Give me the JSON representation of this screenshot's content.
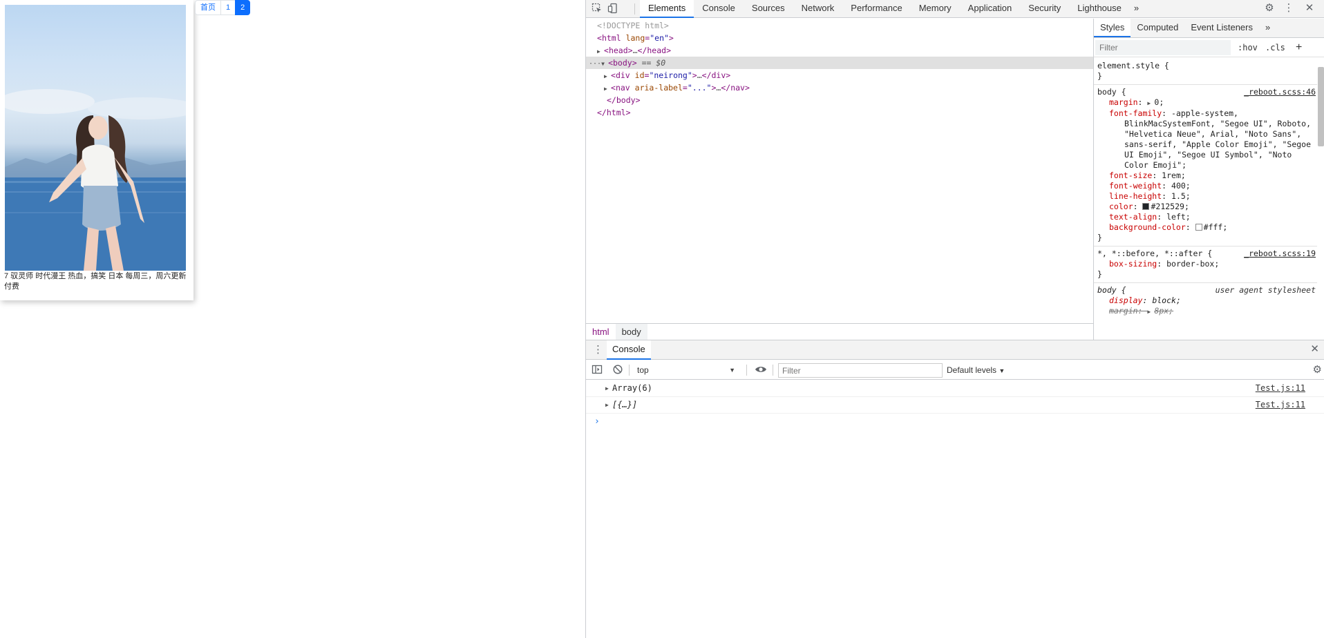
{
  "page": {
    "caption": "7 驭灵师 时代漫王 热血，搞笑 日本 每周三，周六更新付费",
    "pagination": [
      "首页",
      "1",
      "2"
    ]
  },
  "devtools": {
    "tabs": [
      "Elements",
      "Console",
      "Sources",
      "Network",
      "Performance",
      "Memory",
      "Application",
      "Security",
      "Lighthouse"
    ],
    "more_tabs": "»",
    "elements": {
      "doctype": "<!DOCTYPE html>",
      "html_open_tag": "html",
      "html_attr_name": "lang",
      "html_attr_value": "\"en\"",
      "head_tag": "head",
      "body_tag": "body",
      "body_marker": "== $0",
      "div_tag": "div",
      "div_attr_name": "id",
      "div_attr_value": "\"neirong\"",
      "nav_tag": "nav",
      "nav_attr_name": "aria-label",
      "nav_attr_value": "\"...\"",
      "ellipsis": "…",
      "dots": "···"
    },
    "breadcrumbs": [
      "html",
      "body"
    ],
    "styles": {
      "tabs": [
        "Styles",
        "Computed",
        "Event Listeners"
      ],
      "more": "»",
      "filter_placeholder": "Filter",
      "hov": ":hov",
      "cls": ".cls",
      "plus": "+",
      "element_style": "element.style {",
      "close_brace": "}",
      "rule_body": {
        "selector": "body {",
        "source": "_reboot.scss:46",
        "decls": [
          {
            "prop": "margin",
            "value": "0;",
            "arrow": true
          },
          {
            "prop": "font-family",
            "value": "-apple-system, BlinkMacSystemFont, \"Segoe UI\", Roboto, \"Helvetica Neue\", Arial, \"Noto Sans\", sans-serif, \"Apple Color Emoji\", \"Segoe UI Emoji\", \"Segoe UI Symbol\", \"Noto Color Emoji\";"
          },
          {
            "prop": "font-size",
            "value": "1rem;"
          },
          {
            "prop": "font-weight",
            "value": "400;"
          },
          {
            "prop": "line-height",
            "value": "1.5;"
          },
          {
            "prop": "color",
            "value": "#212529;",
            "swatch": "#212529"
          },
          {
            "prop": "text-align",
            "value": "left;"
          },
          {
            "prop": "background-color",
            "value": "#fff;",
            "swatch": "#ffffff"
          }
        ]
      },
      "rule_star": {
        "selector": "*, *::before, *::after {",
        "source": "_reboot.scss:19",
        "decls": [
          {
            "prop": "box-sizing",
            "value": "border-box;"
          }
        ]
      },
      "rule_ua": {
        "selector": "body {",
        "source": "user agent stylesheet",
        "decls": [
          {
            "prop": "display",
            "value": "block;"
          },
          {
            "prop": "margin",
            "value": "8px;",
            "arrow": true
          }
        ]
      }
    },
    "drawer": {
      "tab": "Console",
      "context": "top",
      "filter_placeholder": "Filter",
      "levels": "Default levels",
      "messages": [
        {
          "text": "Array(6)",
          "source": "Test.js:11"
        },
        {
          "text": "[{…}]",
          "source": "Test.js:11"
        }
      ],
      "prompt": "›"
    }
  }
}
